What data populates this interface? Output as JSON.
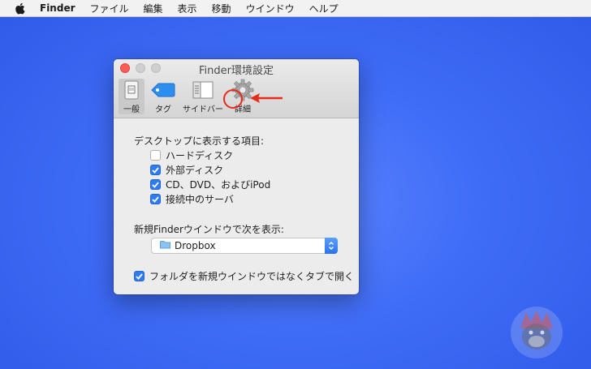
{
  "menubar": {
    "apple_icon": "apple-icon",
    "items": [
      "Finder",
      "ファイル",
      "編集",
      "表示",
      "移動",
      "ウインドウ",
      "ヘルプ"
    ]
  },
  "window": {
    "title": "Finder環境設定",
    "toolbar": {
      "general": "一般",
      "tags": "タグ",
      "sidebar": "サイドバー",
      "advanced": "詳細"
    },
    "desktop_section": {
      "label": "デスクトップに表示する項目:",
      "items": [
        {
          "label": "ハードディスク",
          "checked": false
        },
        {
          "label": "外部ディスク",
          "checked": true
        },
        {
          "label": "CD、DVD、およびiPod",
          "checked": true
        },
        {
          "label": "接続中のサーバ",
          "checked": true
        }
      ]
    },
    "new_window_section": {
      "label": "新規Finderウインドウで次を表示:",
      "selected": "Dropbox"
    },
    "open_folders_in_tabs": {
      "label": "フォルダを新規ウインドウではなくタブで開く",
      "checked": true
    }
  },
  "colors": {
    "desktop": "#3f6cf7",
    "checkbox_accent": "#2f7bf5",
    "annotation_red": "#e82a1a"
  }
}
